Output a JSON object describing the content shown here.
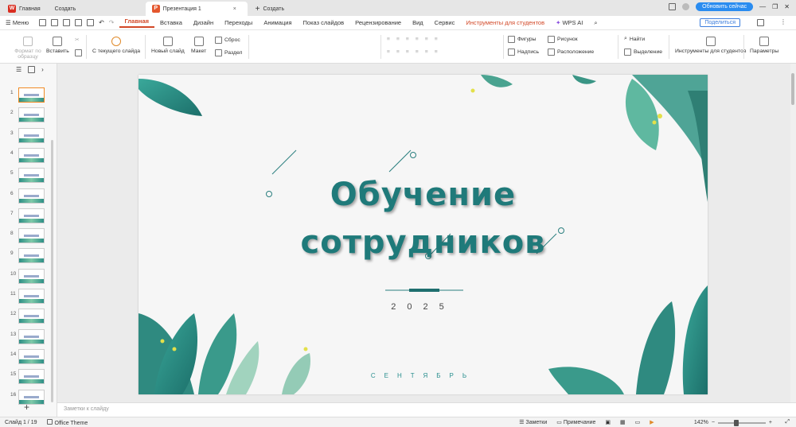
{
  "tabs": [
    {
      "label": "Главная",
      "active": false
    },
    {
      "label": "Создать",
      "active": false
    },
    {
      "label": "Презентация 1",
      "active": true
    },
    {
      "label": "Создать",
      "active": false
    }
  ],
  "upgrade_label": "Обновить сейчас",
  "menu": {
    "main_label": "Меню",
    "items": [
      "Главная",
      "Вставка",
      "Дизайн",
      "Переходы",
      "Анимация",
      "Показ слайдов",
      "Рецензирование",
      "Вид",
      "Сервис",
      "Инструменты для студентов",
      "WPS AI"
    ],
    "share_label": "Поделиться"
  },
  "ribbon": {
    "format_painter": "Формат по образцу",
    "paste": "Вставить",
    "from_current": "С текущего слайда",
    "new_slide": "Новый слайд",
    "layout": "Макет",
    "reset": "Сброс",
    "section": "Раздел",
    "shapes": "Фигуры",
    "picture": "Рисунок",
    "textbox": "Надпись",
    "arrange": "Расположение",
    "find": "Найти",
    "select": "Выделение",
    "student_tools": "Инструменты для студентов",
    "params": "Параметры"
  },
  "thumbnails": [
    "1",
    "2",
    "3",
    "4",
    "5",
    "6",
    "7",
    "8",
    "9",
    "10",
    "11",
    "12",
    "13",
    "14",
    "15",
    "16"
  ],
  "slide": {
    "title_line1": "Обучение",
    "title_line2": "сотрудников",
    "year": "2025",
    "month": "СЕНТЯБРЬ"
  },
  "notes_placeholder": "Заметки к слайду",
  "status": {
    "slide_counter": "Слайд 1 / 19",
    "theme": "Office Theme",
    "notes": "Заметки",
    "comment": "Примечание",
    "zoom": "142%"
  },
  "colors": {
    "accent": "#d24726",
    "teal": "#1f7a7a",
    "leaf": "#2d8f86"
  }
}
